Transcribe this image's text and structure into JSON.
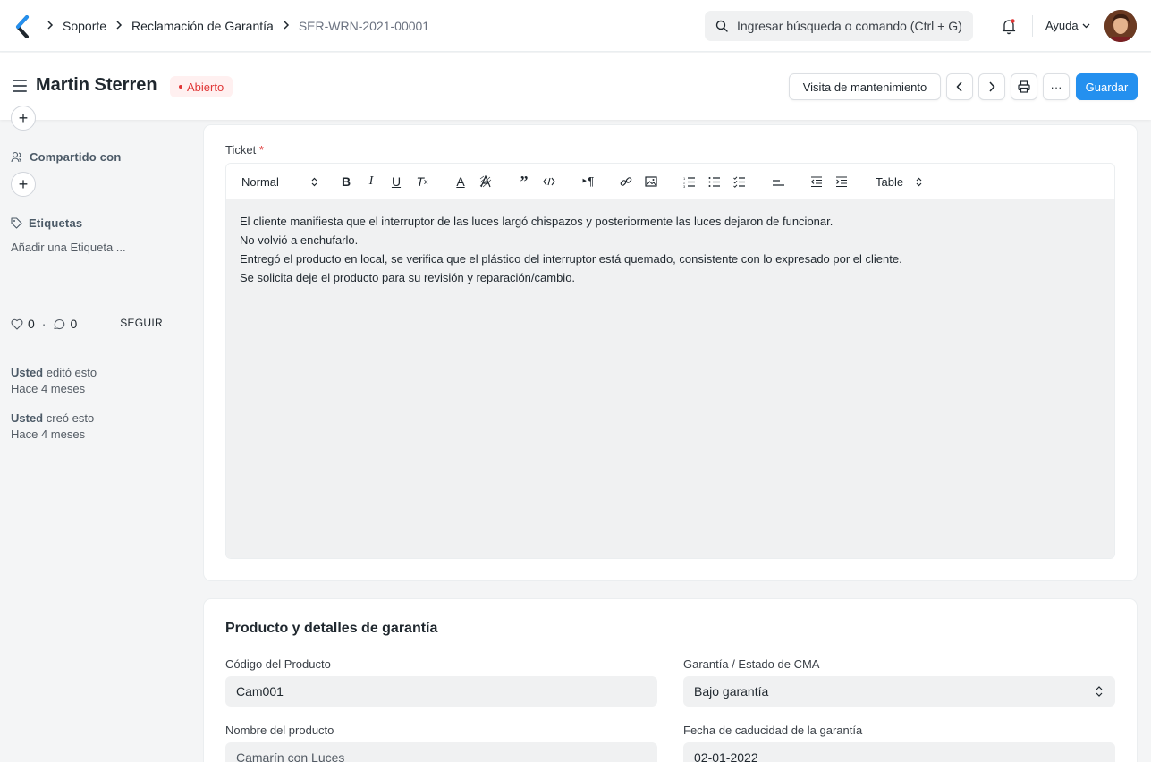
{
  "navbar": {
    "breadcrumbs": [
      "Soporte",
      "Reclamación de Garantía",
      "SER-WRN-2021-00001"
    ],
    "search_placeholder": "Ingresar búsqueda o comando (Ctrl + G)",
    "help_label": "Ayuda"
  },
  "header": {
    "title": "Martin Sterren",
    "status": "Abierto",
    "status_color": "#e03636",
    "visit_button": "Visita de mantenimiento",
    "more_label": "···",
    "save_button": "Guardar",
    "accent": "#2490ef"
  },
  "sidebar": {
    "shared_label": "Compartido con",
    "tags_label": "Etiquetas",
    "add_tag": "Añadir una Etiqueta ...",
    "likes": "0",
    "comments": "0",
    "dot": "·",
    "follow": "SEGUIR",
    "activity": [
      {
        "who": "Usted",
        "what": " editó esto",
        "when": "Hace 4 meses"
      },
      {
        "who": "Usted",
        "what": " creó esto",
        "when": "Hace 4 meses"
      }
    ]
  },
  "ticket": {
    "label": "Ticket",
    "required_mark": "*",
    "toolbar": {
      "style_select": "Normal",
      "table_select": "Table"
    },
    "lines": [
      "El cliente manifiesta que el interruptor de las luces largó chispazos y posteriormente las luces dejaron de funcionar.",
      "No volvió a enchufarlo.",
      "Entregó el producto en local, se verifica que el plástico del interruptor está quemado, consistente con lo expresado por el cliente.",
      "Se solicita deje el producto para su revisión y reparación/cambio."
    ]
  },
  "product_section": {
    "title": "Producto y detalles de garantía",
    "item_code_label": "Código del Producto",
    "item_code_value": "Cam001",
    "warranty_status_label": "Garantía / Estado de CMA",
    "warranty_status_value": "Bajo garantía",
    "item_name_label": "Nombre del producto",
    "item_name_value": "Camarín con Luces",
    "expiry_label": "Fecha de caducidad de la garantía",
    "expiry_value": "02-01-2022"
  }
}
